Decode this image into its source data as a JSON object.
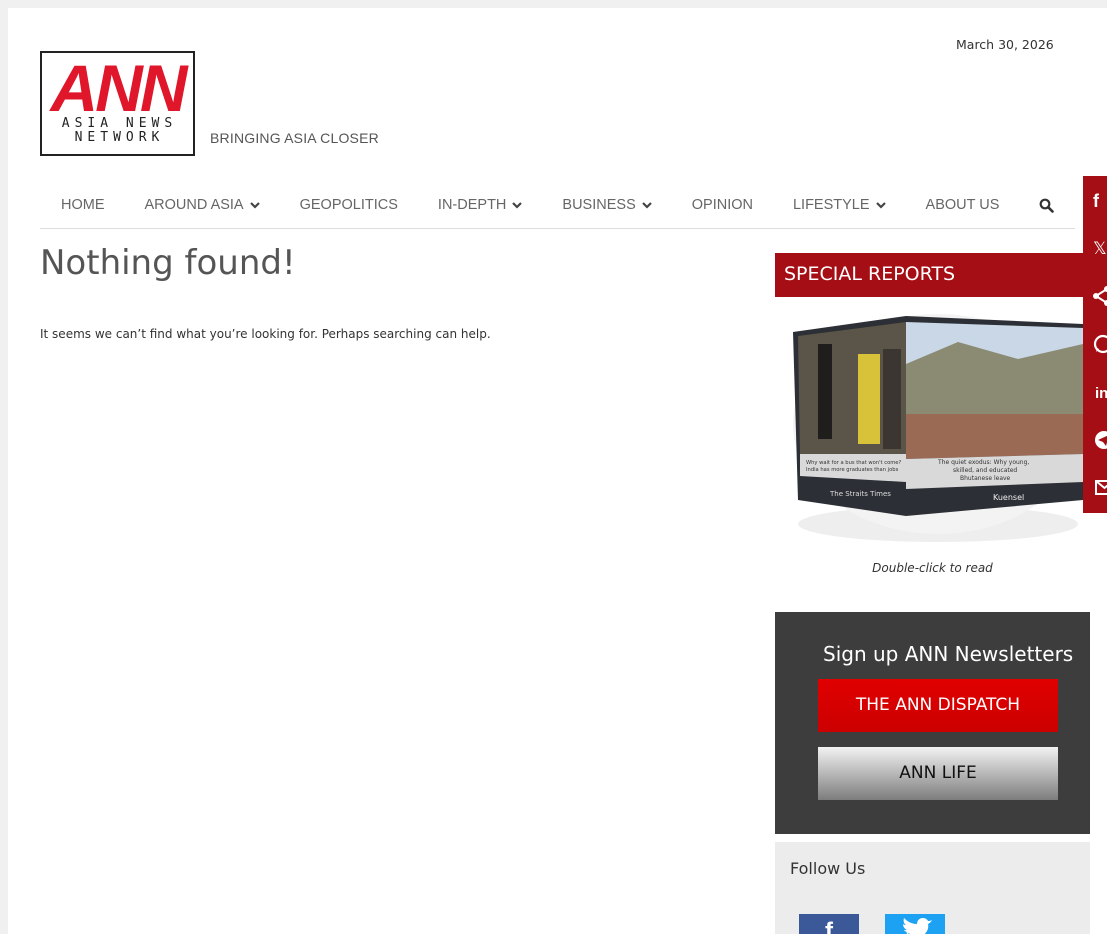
{
  "header": {
    "date": "March 30, 2026",
    "logo": {
      "main": "ANN",
      "line1": "ASIA NEWS",
      "line2": "NETWORK"
    },
    "tagline": "BRINGING ASIA CLOSER"
  },
  "nav": {
    "items": [
      {
        "label": "HOME",
        "dropdown": false
      },
      {
        "label": "AROUND ASIA",
        "dropdown": true
      },
      {
        "label": "GEOPOLITICS",
        "dropdown": false
      },
      {
        "label": "IN-DEPTH",
        "dropdown": true
      },
      {
        "label": "BUSINESS",
        "dropdown": true
      },
      {
        "label": "OPINION",
        "dropdown": false
      },
      {
        "label": "LIFESTYLE",
        "dropdown": true
      },
      {
        "label": "ABOUT US",
        "dropdown": false
      }
    ],
    "search_icon": "search-icon"
  },
  "main": {
    "title": "Nothing found!",
    "message": "It seems we can’t find what you’re looking for. Perhaps searching can help."
  },
  "sidebar": {
    "special_reports": {
      "title": "SPECIAL REPORTS",
      "left_panel": {
        "headline": "Why wait for a bus that won't come? India has more graduates than jobs",
        "source": "The Straits Times"
      },
      "right_panel": {
        "headline": "The quiet exodus: Why young, skilled, and educated Bhutanese leave",
        "source": "Kuensel"
      },
      "caption": "Double-click to read"
    },
    "newsletter": {
      "title": "Sign up ANN Newsletters",
      "button_dispatch": "THE ANN DISPATCH",
      "button_life": "ANN LIFE"
    },
    "follow": {
      "title": "Follow Us",
      "facebook_glyph": "f"
    }
  },
  "share_bar": {
    "icons": [
      "facebook-icon",
      "x-icon",
      "share-icon",
      "whatsapp-icon",
      "linkedin-icon",
      "telegram-icon",
      "email-icon"
    ],
    "labels": {
      "facebook": "f",
      "x": "𝕏",
      "linkedin": "in"
    }
  },
  "colors": {
    "brand_red": "#a40e14",
    "logo_red": "#e0162b",
    "newsletter_bg": "#3d3d3d",
    "dispatch_red": "#e00000",
    "facebook": "#3b5998",
    "twitter": "#1da1f2"
  }
}
